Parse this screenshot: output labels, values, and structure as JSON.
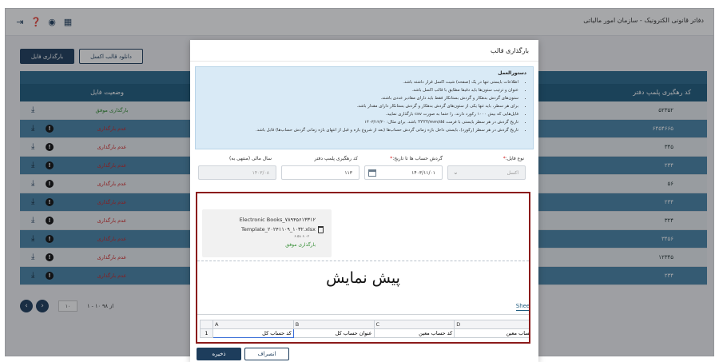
{
  "app": {
    "title": "دفاتر قانونی الکترونیک - سازمان امور مالیاتی",
    "header_icons": [
      "logout-icon",
      "help-icon",
      "eye-icon",
      "grid-icon"
    ],
    "upload_button": "بارگذاری فایل",
    "download_button": "دانلود قالب اکسل"
  },
  "table": {
    "col_status": "وضعیت فایل",
    "col_code": "کد رهگیری پلمپ دفتر",
    "rows": [
      {
        "status": "بارگذاری موفق",
        "ok": true,
        "code": "۵۲۳۵۲"
      },
      {
        "status": "عدم بارگذاری",
        "ok": false,
        "code": "۶۴۵۴۶۶۵"
      },
      {
        "status": "عدم بارگذاری",
        "ok": false,
        "code": "۳۴۵"
      },
      {
        "status": "عدم بارگذاری",
        "ok": false,
        "code": "۲۳۴"
      },
      {
        "status": "عدم بارگذاری",
        "ok": false,
        "code": "۵۶"
      },
      {
        "status": "عدم بارگذاری",
        "ok": false,
        "code": "۲۳۴"
      },
      {
        "status": "عدم بارگذاری",
        "ok": false,
        "code": "۳۲۴"
      },
      {
        "status": "عدم بارگذاری",
        "ok": false,
        "code": "۳۴۵۶"
      },
      {
        "status": "عدم بارگذاری",
        "ok": false,
        "code": "۱۲۳۴۵"
      },
      {
        "status": "عدم بارگذاری",
        "ok": false,
        "code": "۲۳۴"
      }
    ]
  },
  "pager": {
    "page_size": "۱۰",
    "info": "۱ - ۱۰ از ۹۸"
  },
  "modal": {
    "title": "بارگذاری قالب",
    "instructions_title": "دستورالعمل",
    "instructions": [
      "اطلاعات بایستی تنها در یک (صفحه) شیت اکسل قرار داشته باشد.",
      "عنوان و ترتیب ستون‌ها باید دقیقا مطابق با قالب اکسل باشد.",
      "ستون‌های گردش بدهکار و گردش بستانکار فقط باید دارای مقادیر عددی باشند.",
      "برای هر سطر، باید تنها یکی از ستون‌های گردش بدهکار و گردش بستانکار دارای مقدار باشد.",
      "فایل‌هایی که بیش ۱۰۰۰ رکورد دارند، را حتما به صورت csv بارگذاری نمایید.",
      "تاریخ گردش در هر سطر بایستی با فرمت YYYY/mm/dd باشد. برای مثال: ۱۴۰۳/۱۲/۲۰",
      "تاریخ گردش در هر سطر (رکورد)، بایستی داخل بازه زمانی گردش حساب‌ها (بعد از شروع بازه و قبل از انتهای بازه زمانی گردش حساب‌ها) قابل باشد."
    ],
    "fields": {
      "file_type_label": "نوع فایل:",
      "file_type_value": "اکسل",
      "date_label": "گردش حساب ها تا تاریخ:",
      "date_value": "۱۴۰۳/۱۱/۰۱",
      "code_label": "کد رهگیری پلمپ دفتر",
      "code_value": "۱۱۳",
      "year_label": "سال مالی (منتهی به)",
      "year_value": "۱۴۰۳/۰۸"
    },
    "file": {
      "name_line1": "Electronic Books_۷۸۹۴۵۶۱۳۳۱۲",
      "name_line2": "Template_۲۰۲۴۱۱۰۹_۱۰۳۲.xlsx",
      "size": "۶.۵۸ ۶.۰۲",
      "status": "بارگذاری موفق"
    },
    "preview_title": "پیش نمایش",
    "sheet_tab": "Sheet",
    "grid": {
      "columns": [
        "A",
        "B",
        "C",
        "D"
      ],
      "row_number": "1",
      "cells": [
        "کد حساب کل",
        "عنوان حساب کل",
        "کد حساب معین",
        "حساب معین"
      ]
    },
    "save": "ذخیره",
    "cancel": "انصراف"
  }
}
